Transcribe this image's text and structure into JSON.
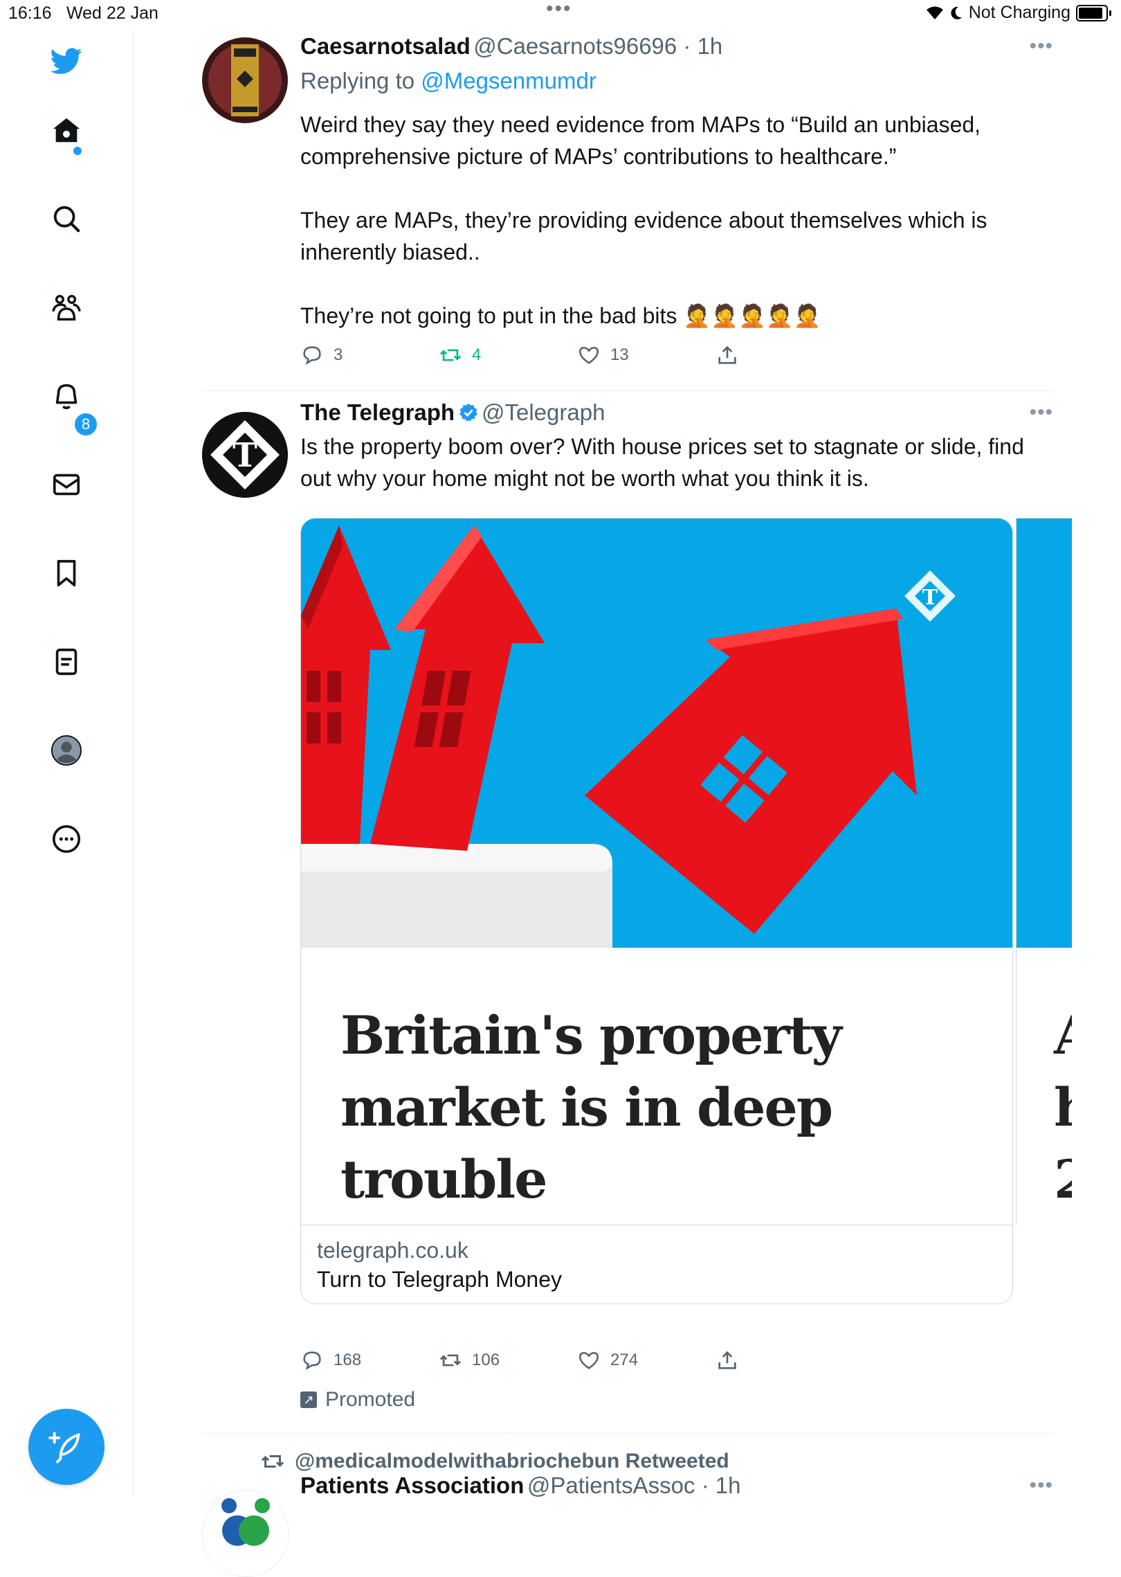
{
  "status_bar": {
    "time": "16:16",
    "date": "Wed 22 Jan",
    "battery_status": "Not Charging"
  },
  "sidebar": {
    "notifications_badge": "8",
    "items": [
      "twitter-logo",
      "home",
      "explore",
      "communities",
      "notifications",
      "messages",
      "bookmarks",
      "lists",
      "profile",
      "more"
    ]
  },
  "tweets": [
    {
      "name": "Caesarnotsalad",
      "handle": "@Caesarnots96696 · 1h",
      "replying_prefix": "Replying to ",
      "replying_to": "@Megsenmumdr",
      "text_p1": "Weird they say they need evidence from MAPs to “Build an unbiased, comprehensive picture of MAPs’ contributions to healthcare.”",
      "text_p2": "They are MAPs, they’re providing evidence about themselves which is inherently biased..",
      "text_p3": "They’re not going to put in the bad bits",
      "emoji": "🤦🤦🤦🤦🤦",
      "replies": "3",
      "retweets": "4",
      "likes": "13"
    },
    {
      "name": "The Telegraph",
      "handle": "@Telegraph",
      "text": "Is the property boom over? With house prices set to stagnate or slide, find out why your home might not be worth what you think it is.",
      "card_headline": "Britain's property market is in deep trouble",
      "card_domain": "telegraph.co.uk",
      "card_subtitle": "Turn to Telegraph Money",
      "next_card_text": "A h 2",
      "replies": "168",
      "retweets": "106",
      "likes": "274",
      "promoted": "Promoted"
    },
    {
      "retweeted_by": "@medicalmodelwithabriochebun Retweeted",
      "name": "Patients Association",
      "handle": "@PatientsAssoc · 1h"
    }
  ],
  "colors": {
    "accent": "#1d9bf0",
    "retweet_green": "#00ba7c",
    "card_sky": "#06a7e6",
    "house_red": "#e8121b"
  }
}
